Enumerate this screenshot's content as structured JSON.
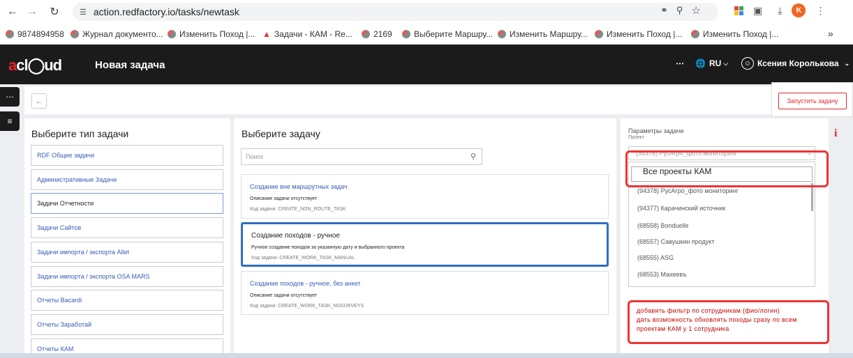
{
  "browser": {
    "url": "action.redfactory.io/tasks/newtask",
    "profile_initial": "K",
    "bookmarks": [
      "9874894958",
      "Журнал документо...",
      "Изменить Поход |...",
      "Задачи - КАМ - Re...",
      "2169",
      "Выберите Маршру...",
      "Изменить Маршру...",
      "Изменить Поход |...",
      "Изменить Поход |..."
    ],
    "bookmarks_more": "»"
  },
  "header": {
    "logo_red": "a",
    "logo_rest": "cl◯ud",
    "title": "Новая задача",
    "lang": "RU",
    "user": "Ксения Королькова"
  },
  "toolbar": {
    "run_label": "Запустить задачу"
  },
  "types": {
    "title": "Выберите тип задачи",
    "items": [
      "RDF Общие задачи",
      "Административные Задачи",
      "Задачи Отчетности",
      "Задачи Сайтов",
      "Задачи импорта / экспорта Allet",
      "Задачи импорта / экспорта OSA MARS",
      "Отчеты Bacardi",
      "Отчеты Заработай",
      "Отчеты КАМ"
    ]
  },
  "tasks": {
    "title": "Выберите задачу",
    "search_placeholder": "Поиск",
    "items": [
      {
        "name": "Создание вне маршрутных задач",
        "desc": "Описание задачи отсутствует",
        "code": "Код задачи: CREATE_NON_ROUTE_TASK"
      },
      {
        "name": "Создание походов - ручное",
        "desc": "Ручное создание походов за указанную дату и выбранного проекта",
        "code": "Код задачи: CREATE_WORK_TASK_MANUAL"
      },
      {
        "name": "Создание походов - ручное, без анкет",
        "desc": "Описание задачи отсутствует",
        "code": "Код задачи: CREATE_WORK_TASK_NOSURVEYS"
      }
    ]
  },
  "params": {
    "title": "Параметры задачи",
    "project_label": "Проект",
    "select_value": "(94378) РусАгро_фото мониторинг",
    "annotation": "Все проекты КАМ",
    "options": [
      "(94378) РусАгро_фото мониторинг",
      "(94377) Карачинский источник",
      "(68558) Bonduelle",
      "(68557) Савушкин продукт",
      "(68555) ASG",
      "(68553) Махеевъ"
    ],
    "comment_lines": [
      "добавить фильтр по сотрудникам (фио/логин)",
      "дать возможность обновлять походы сразу по всем",
      "проектам КАМ у 1 сотрудника"
    ]
  },
  "colors": {
    "accent": "#e5262b",
    "link": "#3a5bb7",
    "selected_border": "#2f6fc0",
    "annotation": "#e33333"
  }
}
